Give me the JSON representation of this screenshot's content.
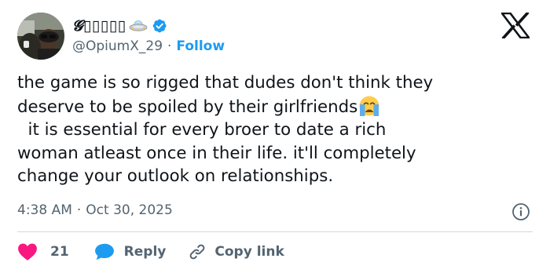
{
  "author": {
    "display_name": "𝓖▯▯▯▯▯",
    "handle": "@OpiumX_29",
    "follow_label": "Follow",
    "avatar_icon": "profile-photo",
    "badge_icon": "ufo-emoji",
    "verified_icon": "verified-badge",
    "verified_color": "#1d9bf0"
  },
  "platform": {
    "logo_icon": "x-logo"
  },
  "tweet": {
    "line1": "the game is so rigged that dudes don't think they",
    "line2": "deserve to be spoiled by their girlfriends",
    "line2_emoji": "crying-face-emoji",
    "line3": "  it is essential for every broer to date a rich",
    "line4": "woman atleast once in their life. it'll completely",
    "line5": "change your outlook on relationships."
  },
  "meta": {
    "time": "4:38 AM",
    "separator": "·",
    "date": "Oct 30, 2025",
    "info_icon": "info-icon"
  },
  "actions": {
    "like_count": "21",
    "reply_label": "Reply",
    "copy_link_label": "Copy link"
  },
  "colors": {
    "text": "#0f1419",
    "secondary": "#536471",
    "accent": "#1d9bf0",
    "like": "#f91880",
    "divider": "#cfd9de"
  }
}
